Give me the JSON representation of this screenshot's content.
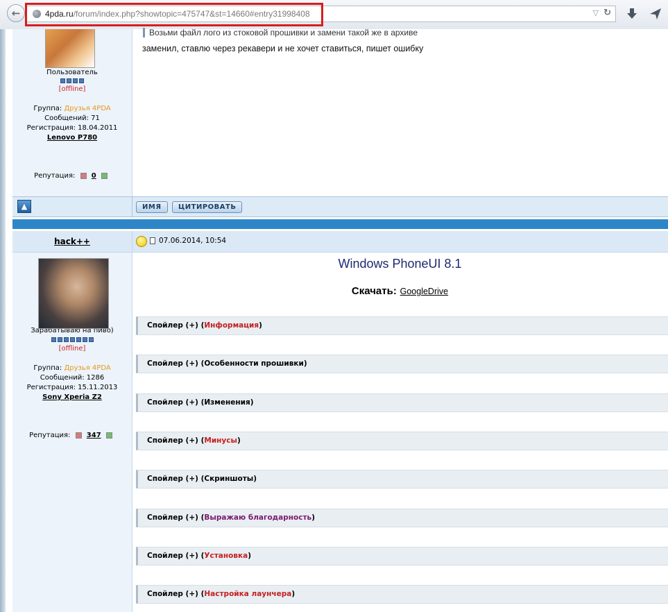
{
  "browser": {
    "url_host": "4pda.ru",
    "url_path": "/forum/index.php?showtopic=475747&st=14660#entry31998408",
    "icons": [
      "back-arrow-icon",
      "globe-icon",
      "dropdown-icon",
      "reload-icon",
      "download-icon",
      "send-icon"
    ]
  },
  "post1": {
    "quote": "Возьми файл лого из стоковой прошивки и замени такой же в архиве",
    "text": "заменил, ставлю через рекавери и не хочет ставиться, пишет ошибку",
    "user": {
      "title": "Пользователь",
      "status": "[offline]",
      "group_label": "Группа:",
      "group_value": "Друзья 4PDA",
      "messages": "Сообщений: 71",
      "registration": "Регистрация: 18.04.2011",
      "device": "Lenovo P780",
      "reputation_label": "Репутация:",
      "reputation_value": "0"
    }
  },
  "actions": {
    "name_btn": "ИМЯ",
    "quote_btn": "ЦИТИРОВАТЬ"
  },
  "post2": {
    "author": "hack++",
    "date": "07.06.2014, 10:54",
    "title": "Windows PhoneUI 8.1",
    "download_label": "Скачать:",
    "download_link": "GoogleDrive",
    "user": {
      "title": "Зарабатываю на пиво)",
      "status": "[offline]",
      "group_label": "Группа:",
      "group_value": "Друзья 4PDA",
      "messages": "Сообщений: 1286",
      "registration": "Регистрация: 15.11.2013",
      "device": "Sony Xperia Z2",
      "reputation_label": "Репутация:",
      "reputation_value": "347"
    },
    "spoilers": [
      {
        "prefix": "Спойлер (+) (",
        "label": "Информация",
        "suffix": ")",
        "color": "#c41f1f"
      },
      {
        "prefix": "Спойлер (+) (",
        "label": "Особенности прошивки",
        "suffix": ")",
        "color": "#000000"
      },
      {
        "prefix": "Спойлер (+) (",
        "label": "Изменения",
        "suffix": ")",
        "color": "#000000"
      },
      {
        "prefix": "Спойлер (+) (",
        "label": "Минусы",
        "suffix": ")",
        "color": "#c41f1f"
      },
      {
        "prefix": "Спойлер (+) (",
        "label": "Скриншоты",
        "suffix": ")",
        "color": "#000000"
      },
      {
        "prefix": "Спойлер (+) (",
        "label": "Выражаю благодарность",
        "suffix": ")",
        "color": "#7a1a6e"
      },
      {
        "prefix": "Спойлер (+) (",
        "label": "Установка",
        "suffix": ")",
        "color": "#c41f1f"
      },
      {
        "prefix": "Спойлер (+) (",
        "label": "Настройка лаунчера",
        "suffix": ")",
        "color": "#c41f1f"
      }
    ]
  }
}
